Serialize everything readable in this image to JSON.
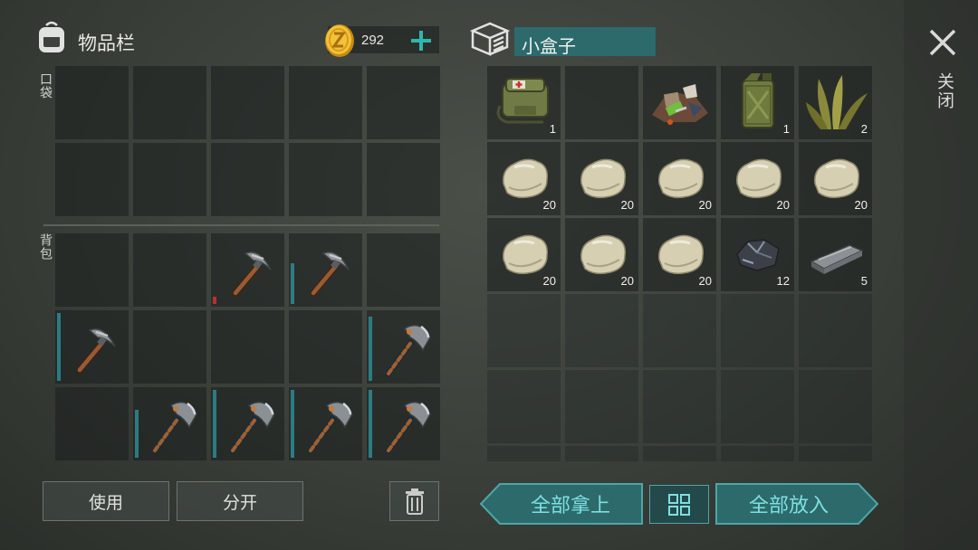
{
  "left_panel": {
    "title": "物品栏",
    "currency": {
      "amount": "292",
      "icon": "gold-coin-icon",
      "add_icon": "plus-icon"
    },
    "pocket_label": "口袋",
    "backpack_label": "背包",
    "pocket_slots": [
      "",
      "",
      "",
      "",
      "",
      "",
      "",
      "",
      "",
      ""
    ],
    "backpack_slots": [
      {
        "item": "",
        "count": ""
      },
      {
        "item": "",
        "count": ""
      },
      {
        "item": "pickaxe",
        "count": "",
        "durability": 0.1
      },
      {
        "item": "pickaxe",
        "count": "",
        "durability": 0.6
      },
      {
        "item": "",
        "count": ""
      },
      {
        "item": "pickaxe",
        "count": "",
        "durability": 1.0
      },
      {
        "item": "",
        "count": ""
      },
      {
        "item": "",
        "count": ""
      },
      {
        "item": "",
        "count": ""
      },
      {
        "item": "hatchet",
        "count": "",
        "durability": 0.95
      },
      {
        "item": "",
        "count": ""
      },
      {
        "item": "hatchet",
        "count": "",
        "durability": 0.7
      },
      {
        "item": "hatchet",
        "count": "",
        "durability": 1.0
      },
      {
        "item": "hatchet",
        "count": "",
        "durability": 1.0
      },
      {
        "item": "hatchet",
        "count": "",
        "durability": 1.0
      }
    ],
    "buttons": {
      "use": "使用",
      "split": "分开",
      "trash_icon": "trash-icon"
    }
  },
  "right_panel": {
    "title": "小盒子",
    "box_icon": "crate-icon",
    "slots": [
      {
        "item": "medkit-bag",
        "count": "1"
      },
      {
        "item": "",
        "count": ""
      },
      {
        "item": "scrap-pile",
        "count": ""
      },
      {
        "item": "jerry-can",
        "count": "1"
      },
      {
        "item": "plant-fiber",
        "count": "2"
      },
      {
        "item": "stone",
        "count": "20"
      },
      {
        "item": "stone",
        "count": "20"
      },
      {
        "item": "stone",
        "count": "20"
      },
      {
        "item": "stone",
        "count": "20"
      },
      {
        "item": "stone",
        "count": "20"
      },
      {
        "item": "stone",
        "count": "20"
      },
      {
        "item": "stone",
        "count": "20"
      },
      {
        "item": "stone",
        "count": "20"
      },
      {
        "item": "iron-ore",
        "count": "12"
      },
      {
        "item": "iron-bar",
        "count": "5"
      }
    ],
    "buttons": {
      "take_all": "全部拿上",
      "sort_icon": "grid-sort-icon",
      "put_all": "全部放入"
    }
  },
  "close": {
    "label": "关闭",
    "icon": "close-x-icon"
  },
  "colors": {
    "accent_teal": "#2c6a6c",
    "teal_text": "#7ee0df",
    "durability": "#2b7c82",
    "durability_low": "#b3322c"
  }
}
